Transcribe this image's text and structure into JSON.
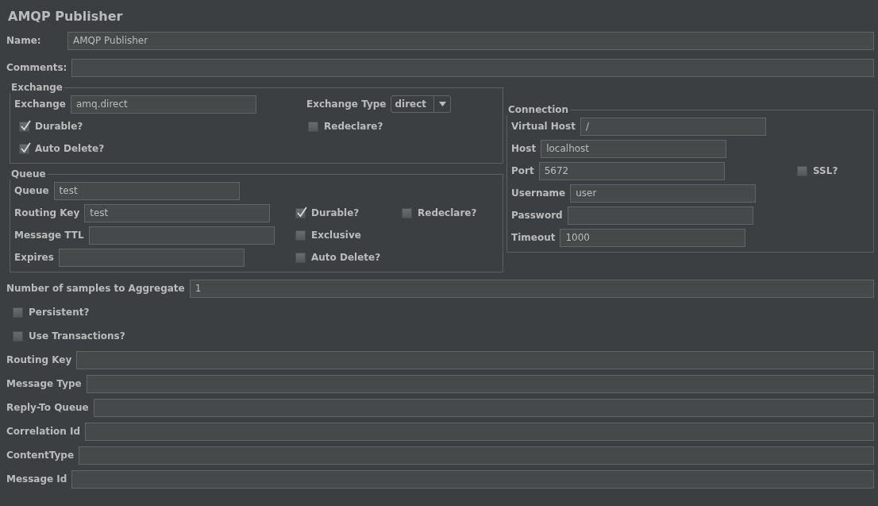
{
  "title": "AMQP Publisher",
  "name": {
    "label": "Name:",
    "value": "AMQP Publisher"
  },
  "comments": {
    "label": "Comments:"
  },
  "exchange": {
    "legend": "Exchange",
    "field": {
      "label": "Exchange",
      "value": "amq.direct"
    },
    "type": {
      "label": "Exchange Type",
      "value": "direct"
    },
    "durable": {
      "label": "Durable?",
      "checked": true
    },
    "redeclare": {
      "label": "Redeclare?",
      "checked": false
    },
    "auto_delete": {
      "label": "Auto Delete?",
      "checked": true
    }
  },
  "queue": {
    "legend": "Queue",
    "fields": [
      {
        "label": "Queue",
        "value": "test"
      },
      {
        "label": "Routing Key",
        "value": "test"
      },
      {
        "label": "Message TTL"
      },
      {
        "label": "Expires"
      }
    ],
    "options": [
      {
        "label": "Durable?",
        "checked": true
      },
      {
        "label": "Redeclare?",
        "checked": false
      },
      {
        "label": "Exclusive",
        "checked": false
      },
      {
        "label": "Auto Delete?",
        "checked": false
      }
    ]
  },
  "connection": {
    "legend": "Connection",
    "fields": [
      {
        "label": "Virtual Host",
        "value": "/"
      },
      {
        "label": "Host",
        "value": "localhost"
      },
      {
        "label": "Port",
        "value": "5672"
      },
      {
        "label": "Username",
        "value": "user"
      },
      {
        "label": "Password"
      },
      {
        "label": "Timeout",
        "value": "1000"
      }
    ],
    "ssl": {
      "label": "SSL?",
      "checked": false
    }
  },
  "samples": {
    "label": "Number of samples to Aggregate",
    "value": "1"
  },
  "options": [
    {
      "label": "Persistent?",
      "checked": false
    },
    {
      "label": "Use Transactions?",
      "checked": false
    }
  ],
  "message_fields": [
    {
      "label": "Routing Key"
    },
    {
      "label": "Message Type"
    },
    {
      "label": "Reply-To Queue"
    },
    {
      "label": "Correlation Id"
    },
    {
      "label": "ContentType"
    },
    {
      "label": "Message Id"
    }
  ]
}
